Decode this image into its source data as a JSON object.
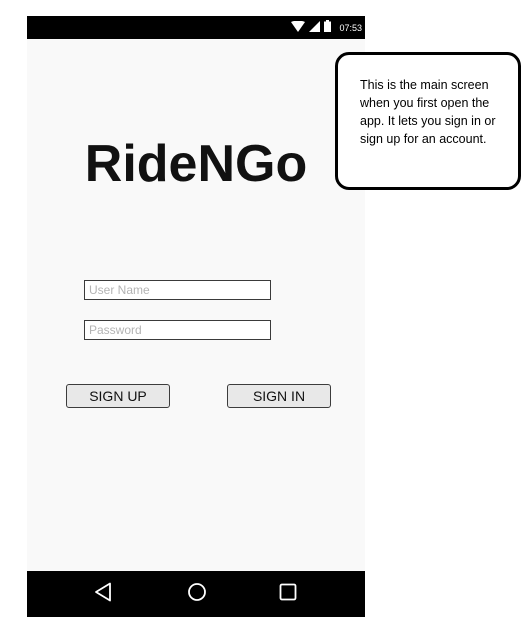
{
  "status_bar": {
    "time": "07:53",
    "icons": [
      "wifi-icon",
      "signal-icon",
      "battery-icon"
    ]
  },
  "app": {
    "title": "RideNGo"
  },
  "login_form": {
    "username_placeholder": "User Name",
    "username_value": "",
    "password_placeholder": "Password",
    "password_value": ""
  },
  "buttons": {
    "sign_up_label": "SIGN UP",
    "sign_in_label": "SIGN IN"
  },
  "nav_bar": {
    "icons": [
      "back-icon",
      "home-icon",
      "recents-icon"
    ]
  },
  "annotation": {
    "text": "This is the main screen when you first open the app. It lets you sign in or sign up for an account."
  },
  "colors": {
    "screen_background": "#f9f9f9",
    "system_bars": "#000000",
    "button_background": "#e8e8e8"
  }
}
